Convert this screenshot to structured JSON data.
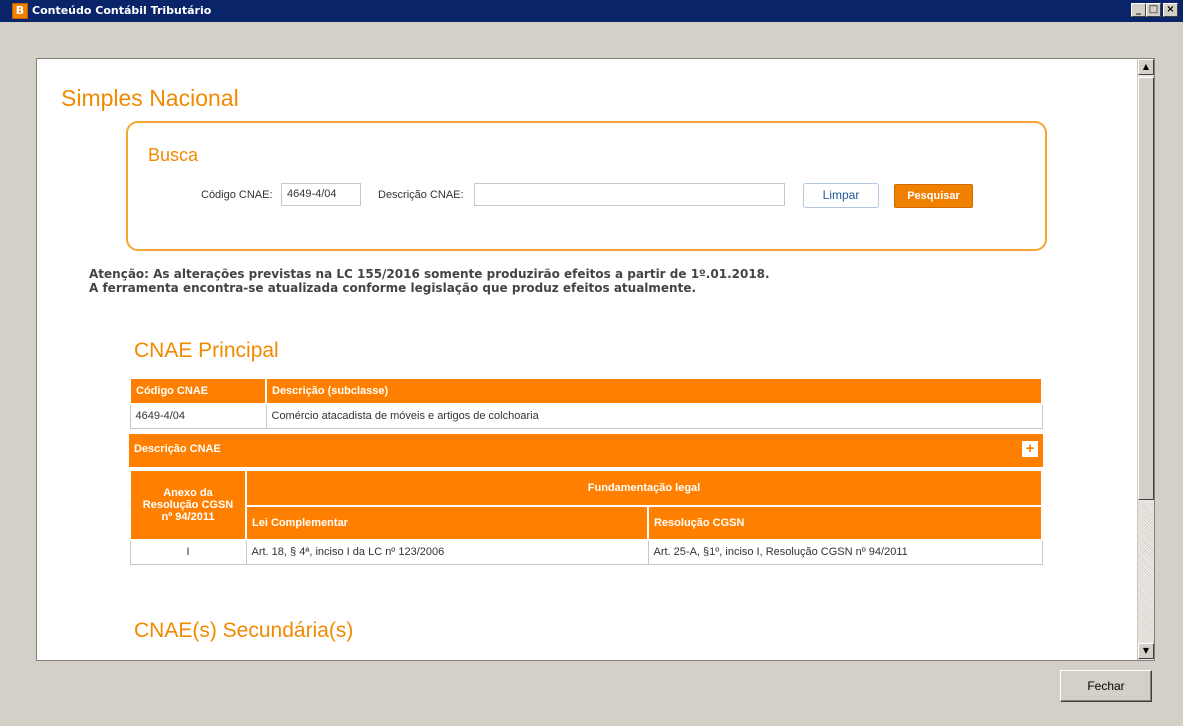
{
  "window": {
    "title": "Conteúdo Contábil Tributário",
    "app_icon": "B",
    "minimize": "_",
    "maximize": "□",
    "close": "×"
  },
  "page": {
    "heading": "Simples Nacional"
  },
  "busca": {
    "title": "Busca",
    "codigo_label": "Código CNAE:",
    "codigo_value": "4649-4/04",
    "descricao_label": "Descrição CNAE:",
    "descricao_value": "",
    "limpar_label": "Limpar",
    "pesquisar_label": "Pesquisar"
  },
  "aviso": {
    "line1": "Atenção: As alterações previstas na LC 155/2016 somente produzirão efeitos a partir de 1º.01.2018.",
    "line2": "A ferramenta encontra-se atualizada conforme legislação que produz efeitos atualmente."
  },
  "cnae_principal": {
    "title": "CNAE Principal",
    "headers": [
      "Código CNAE",
      "Descrição (subclasse)"
    ],
    "rows": [
      [
        "4649-4/04",
        "Comércio atacadista de móveis e artigos de colchoaria"
      ]
    ],
    "descricao_bar": "Descrição CNAE",
    "expand_icon": "+",
    "anexo_header": "Anexo da Resolução CGSN nº 94/2011",
    "fundamentacao_header": "Fundamentação legal",
    "lei_header": "Lei Complementar",
    "resolucao_header": "Resolução CGSN",
    "legal_rows": [
      [
        "I",
        "Art. 18, § 4ª, inciso I da LC nº 123/2006",
        "Art. 25-A, §1º, inciso I, Resolução CGSN nº 94/2011"
      ]
    ]
  },
  "cnae_secundarias": {
    "title": "CNAE(s) Secundária(s)"
  },
  "footer": {
    "fechar_label": "Fechar"
  }
}
